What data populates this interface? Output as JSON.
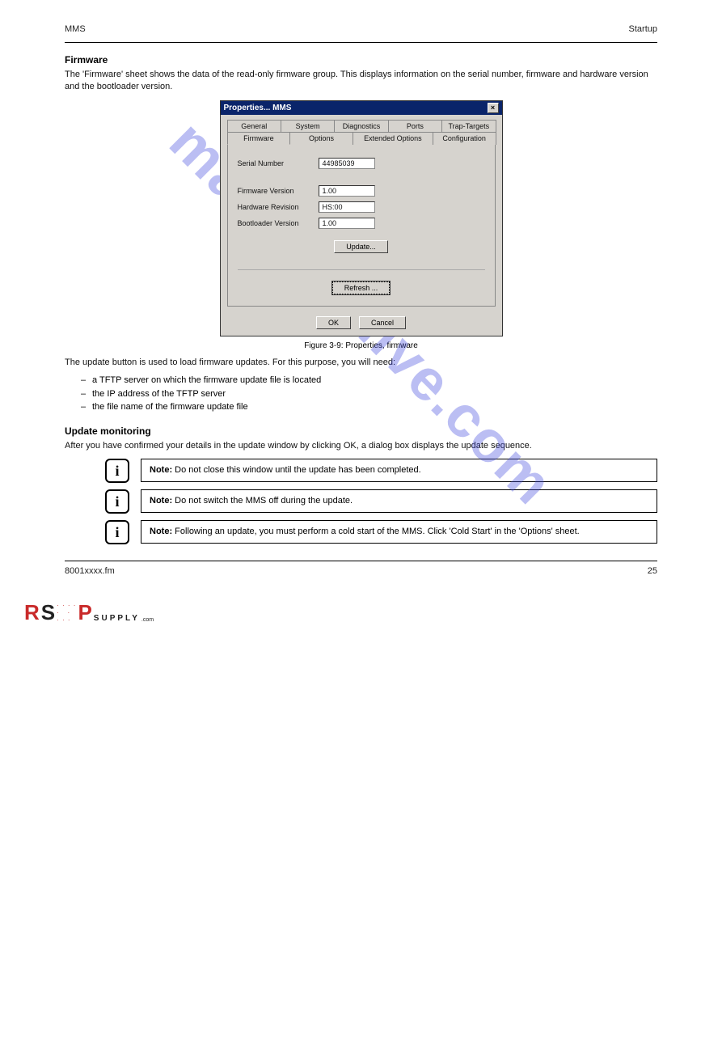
{
  "header": {
    "left": "MMS",
    "right": "Startup"
  },
  "section1": {
    "title": "Firmware",
    "p1": "The 'Firmware' sheet shows the data of the read-only firmware group. This displays information on the serial number, firmware and hardware version and the bootloader version."
  },
  "dialog": {
    "title": "Properties... MMS",
    "tabsRow1": [
      "General",
      "System",
      "Diagnostics",
      "Ports",
      "Trap-Targets"
    ],
    "tabsRow2": [
      "Firmware",
      "Options",
      "Extended Options",
      "Configuration"
    ],
    "fields": {
      "serial": {
        "label": "Serial Number",
        "value": "44985039"
      },
      "fw": {
        "label": "Firmware Version",
        "value": "1.00"
      },
      "hw": {
        "label": "Hardware Revision",
        "value": "HS:00"
      },
      "boot": {
        "label": "Bootloader Version",
        "value": "1.00"
      }
    },
    "buttons": {
      "update": "Update...",
      "refresh": "Refresh ...",
      "ok": "OK",
      "cancel": "Cancel"
    }
  },
  "figure": {
    "caption": "Figure 3-9: Properties, firmware"
  },
  "section2": {
    "p_intro": "The update button is used to load firmware updates. For this purpose, you will need:",
    "picks": [
      "a TFTP server on which the firmware update file is located",
      "the IP address of the TFTP server",
      "the file name of the firmware update file"
    ]
  },
  "update": {
    "title": "Update monitoring",
    "p1": "After you have confirmed your details in the update window by clicking OK, a dialog box displays the update sequence."
  },
  "notes": {
    "n1": {
      "label": "Note:",
      "text": "Do not close this window until the update has been completed."
    },
    "n2": {
      "label": "Note:",
      "text": "Do not switch the MMS off during the update."
    },
    "n3": {
      "label": "Note:",
      "text": "Following an update, you must perform a cold start of the MMS. Click 'Cold Start' in the 'Options' sheet."
    }
  },
  "footer": {
    "left": "8001xxxx.fm",
    "right": "25"
  },
  "watermark": "manualshive.com",
  "logo": {
    "supply": "SUPPLY",
    "com": ".com"
  }
}
